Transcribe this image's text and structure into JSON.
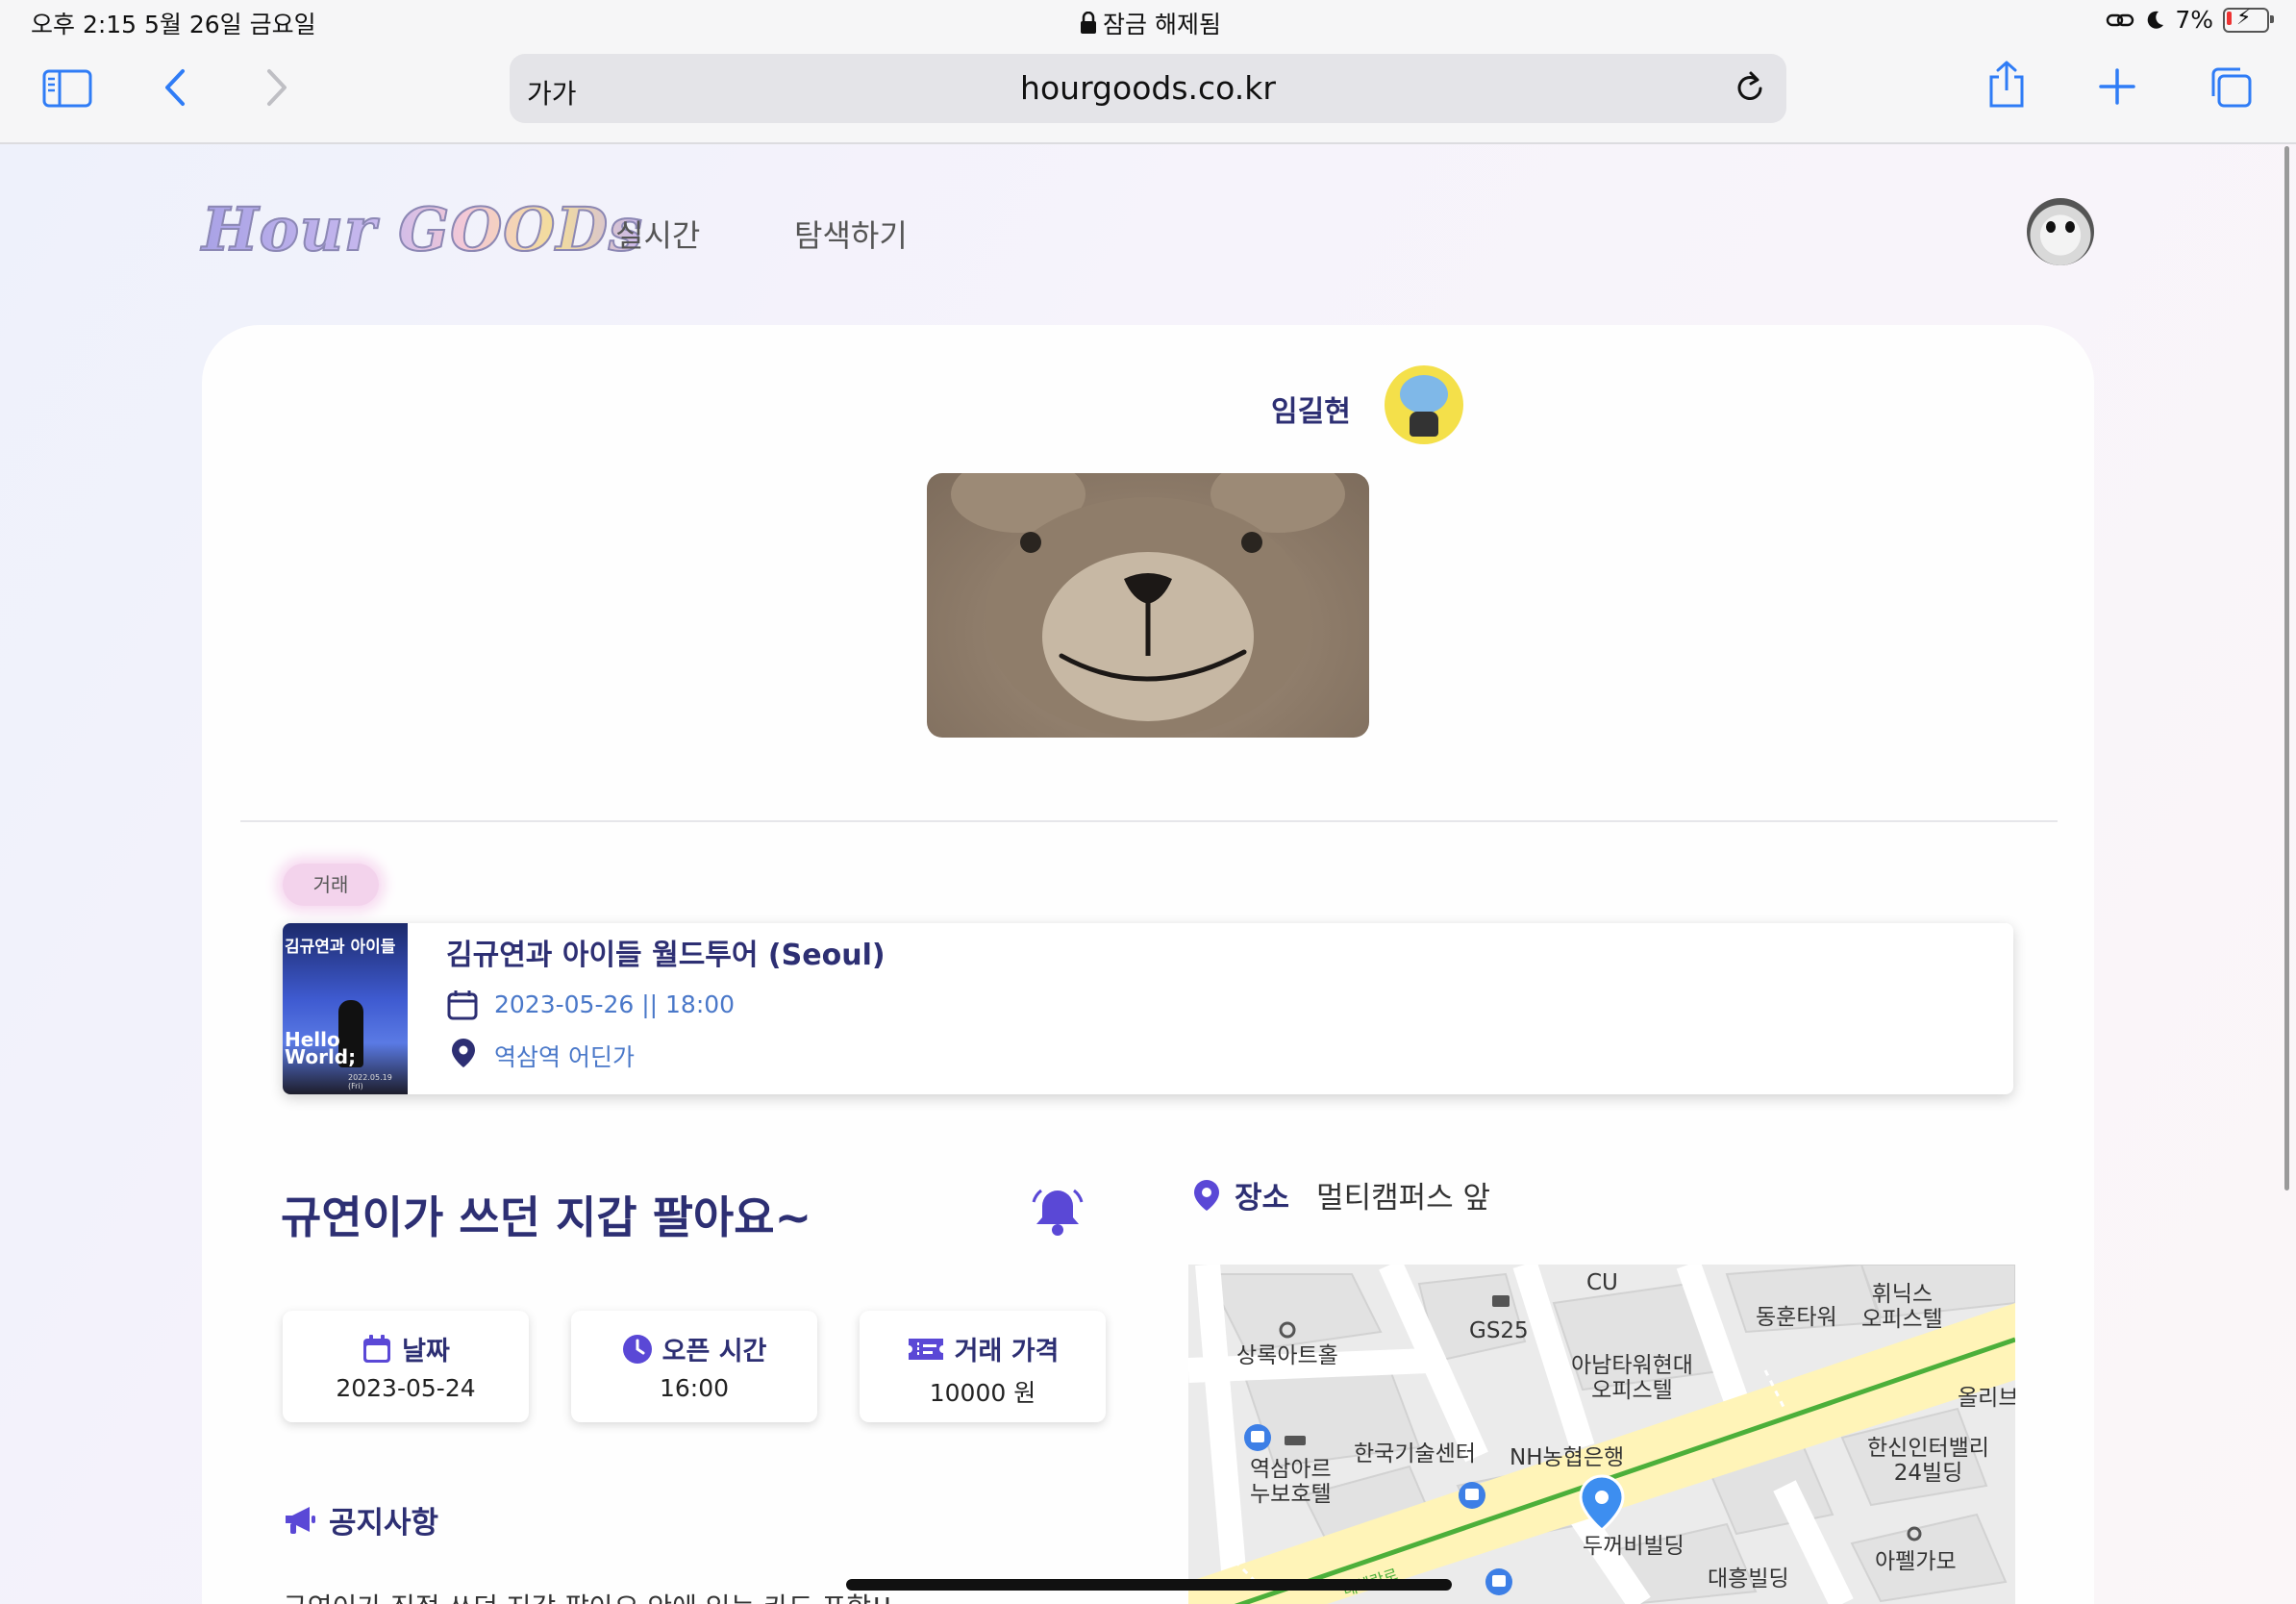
{
  "status_bar": {
    "time": "오후 2:15",
    "date": "5월 26일 금요일",
    "lock_text": "잠금 해제됨",
    "battery": "7%"
  },
  "browser": {
    "aa_label": "가가",
    "url": "hourgoods.co.kr"
  },
  "site": {
    "logo": "Hour GOODs",
    "nav": [
      "실시간",
      "탐색하기"
    ]
  },
  "author": {
    "name": "임길현"
  },
  "trade_tag": "거래",
  "event": {
    "thumb_title": "김규연과 아이들",
    "thumb_hello": "Hello World;",
    "thumb_date": "2022.05.19 (Fri)",
    "title": "김규연과 아이들 월드투어 (Seoul)",
    "datetime": "2023-05-26 || 18:00",
    "place": "역삼역 어딘가"
  },
  "post": {
    "title": "규연이가 쓰던 지갑 팔아요~",
    "info": [
      {
        "label": "날짜",
        "value": "2023-05-24",
        "icon": "calendar-icon"
      },
      {
        "label": "오픈 시간",
        "value": "16:00",
        "icon": "clock-icon"
      },
      {
        "label": "거래 가격",
        "value": "10000 원",
        "icon": "ticket-icon"
      }
    ],
    "notice_heading": "공지사항",
    "notice_body": "규연이가 직접 쓰던 지갑 팔아요 안에 있는 카드 포함!!"
  },
  "place": {
    "label": "장소",
    "value": "멀티캠퍼스 앞"
  },
  "map": {
    "labels": [
      "CU",
      "휘닉스\n오피스텔",
      "동훈타워",
      "GS25",
      "상록아트홀",
      "아남타워현대\n오피스텔",
      "올리브",
      "한신인터밸리\n24빌딩",
      "역삼아르\n누보호텔",
      "한국기술센터",
      "NH농협은행",
      "두꺼비빌딩",
      "대흥빌딩",
      "아펠가모",
      "테헤란로"
    ]
  },
  "colors": {
    "brand_navy": "#2d2f73",
    "accent_purple": "#5a48d6",
    "link_blue": "#4a78c9",
    "map_road": "#fff4b8",
    "map_line": "#4caf3a",
    "map_pin": "#3d8ef0"
  }
}
